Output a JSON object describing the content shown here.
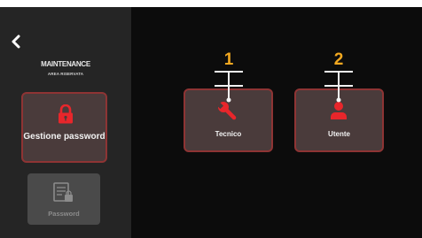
{
  "colors": {
    "screen_bg": "#0c0c0c",
    "sidebar_bg": "#252525",
    "button_fill": "#4a3b3b",
    "button_border": "#8e3434",
    "icon_red": "#e8262b",
    "callout_orange": "#f2a820",
    "disabled_fill": "#4a4a4a"
  },
  "sidebar": {
    "back_icon": "chevron-left-icon",
    "title": "MAINTENANCE",
    "subtitle": "AREA RISERVATA",
    "buttons": [
      {
        "label": "Gestione password",
        "icon": "lock-icon",
        "state": "active"
      },
      {
        "label": "Password",
        "icon": "document-icon",
        "state": "disabled"
      }
    ]
  },
  "main": {
    "buttons": [
      {
        "label": "Tecnico",
        "icon": "wrench-icon"
      },
      {
        "label": "Utente",
        "icon": "person-icon"
      }
    ]
  },
  "callouts": [
    "1",
    "2"
  ]
}
